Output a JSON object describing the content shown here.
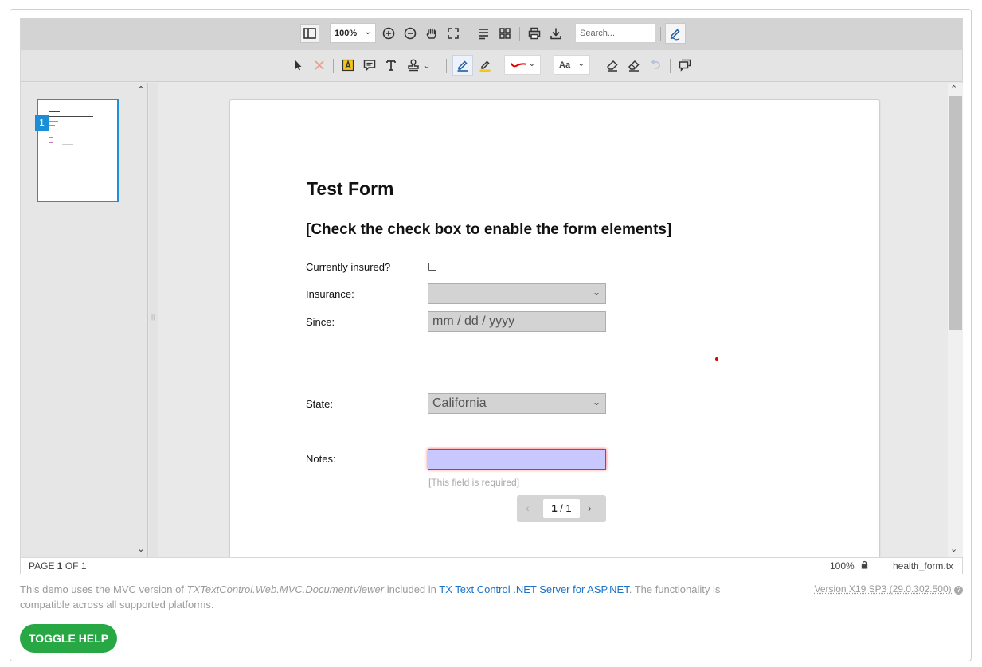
{
  "toolbar": {
    "zoom_value": "100%",
    "search_placeholder": "Search...",
    "font_size_label": "Aa",
    "accent_color": "#1e90d6",
    "ink_color": "#e00000"
  },
  "sidebar": {
    "thumbnail_page_number": "1"
  },
  "document": {
    "title": "Test Form",
    "subtitle": "[Check the check box to enable the form elements]",
    "fields": {
      "insured_label": "Currently insured?",
      "insurance_label": "Insurance:",
      "insurance_value": "",
      "since_label": "Since:",
      "since_placeholder": "mm / dd / yyyy",
      "state_label": "State:",
      "state_value": "California",
      "notes_label": "Notes:",
      "notes_required": "[This field is required]"
    },
    "pager": {
      "current": "1",
      "separator": " / ",
      "total": "1"
    }
  },
  "statusbar": {
    "page_prefix": "PAGE ",
    "page_current": "1",
    "page_of": " OF 1",
    "zoom": "100%",
    "filename": "health_form.tx"
  },
  "footer": {
    "info_part1": "This demo uses the MVC version of ",
    "info_italic": "TXTextControl.Web.MVC.DocumentViewer",
    "info_part2": " included in ",
    "info_link": "TX Text Control .NET Server for ASP.NET",
    "info_part3": ". The functionality is compatible across all supported platforms.",
    "version": "Version X19 SP3 (29.0.302.500)",
    "help_button": "TOGGLE HELP",
    "help_color": "#28a745"
  }
}
